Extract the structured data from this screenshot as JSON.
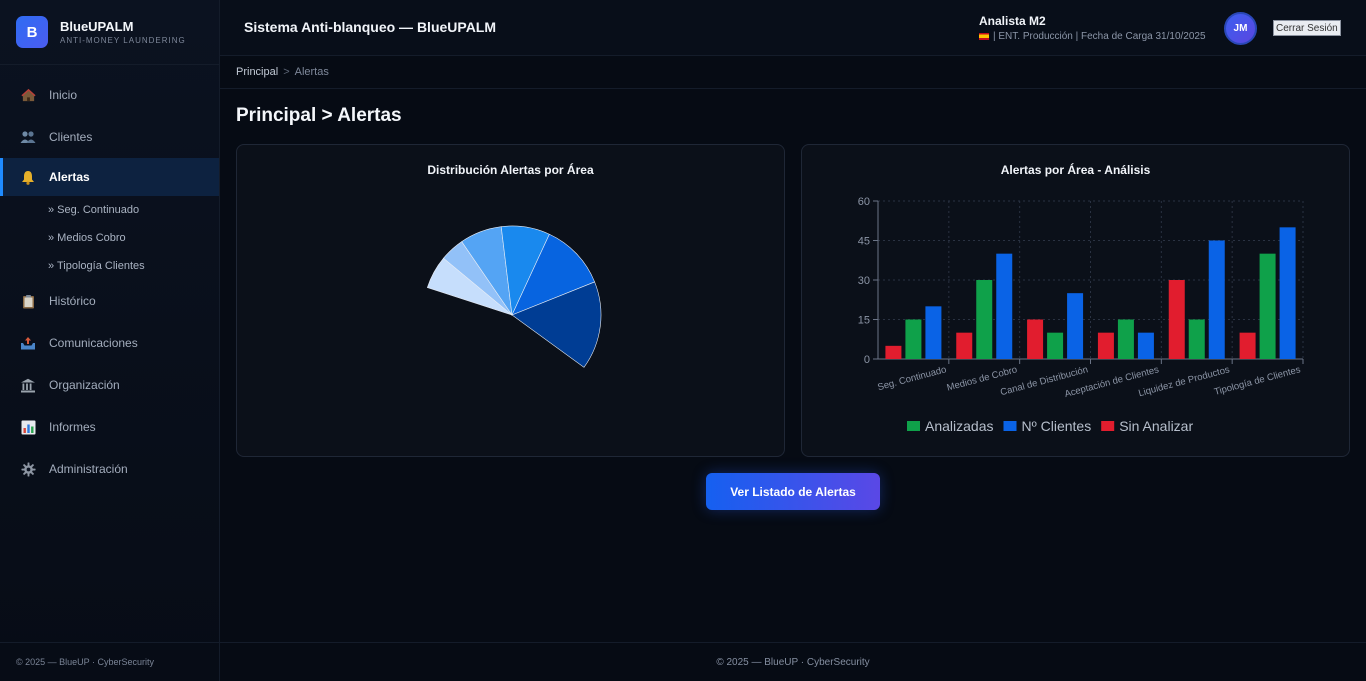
{
  "brand": {
    "logo_letter": "B",
    "name": "BlueUPALM",
    "tagline": "ANTI-MONEY LAUNDERING"
  },
  "sidebar": {
    "items": [
      {
        "label": "Inicio",
        "icon": "house-icon"
      },
      {
        "label": "Clientes",
        "icon": "users-icon"
      },
      {
        "label": "Alertas",
        "icon": "bell-icon",
        "active": true
      },
      {
        "label": "Histórico",
        "icon": "clipboard-icon"
      },
      {
        "label": "Comunicaciones",
        "icon": "outbox-icon"
      },
      {
        "label": "Organización",
        "icon": "bank-icon"
      },
      {
        "label": "Informes",
        "icon": "bar-chart-icon"
      },
      {
        "label": "Administración",
        "icon": "gear-icon"
      }
    ],
    "subitems": [
      "» Seg. Continuado",
      "» Medios Cobro",
      "» Tipología Clientes"
    ],
    "footer": "© 2025 — BlueUP · CyberSecurity"
  },
  "header": {
    "title": "Sistema Anti-blanqueo — BlueUPALM",
    "user_name": "Analista M2",
    "user_meta": "| ENT. Producción | Fecha de Carga 31/10/2025",
    "avatar_initials": "JM",
    "logout_label": "Cerrar Sesión"
  },
  "breadcrumb": {
    "home": "Principal",
    "separator": ">",
    "current": "Alertas"
  },
  "page": {
    "title": "Principal > Alertas",
    "cta_label": "Ver Listado de Alertas",
    "footer": "© 2025 — BlueUP · CyberSecurity"
  },
  "colors": {
    "accent": "#1f8bff",
    "analizadas": "#0fa14a",
    "clientes": "#0a63e6",
    "sin_analizar": "#e11d2e"
  },
  "chart_data": [
    {
      "type": "pie",
      "title": "Distribución Alertas por Área",
      "layout": "semicircle",
      "slices": [
        {
          "value": 15,
          "color": "#c6defc"
        },
        {
          "value": 11,
          "color": "#92c1f8"
        },
        {
          "value": 19,
          "color": "#54a4f4"
        },
        {
          "value": 22,
          "color": "#1989ee"
        },
        {
          "value": 30,
          "color": "#0764e0"
        },
        {
          "value": 40,
          "color": "#003d94"
        }
      ]
    },
    {
      "type": "bar",
      "title": "Alertas por Área - Análisis",
      "categories": [
        "Seg. Continuado",
        "Medios de Cobro",
        "Canal de Distribución",
        "Aceptación de Clientes",
        "Liquidez de Productos",
        "Tipología de Clientes"
      ],
      "series": [
        {
          "name": "Sin Analizar",
          "color": "#e11d2e",
          "values": [
            5,
            10,
            15,
            10,
            30,
            10
          ]
        },
        {
          "name": "Analizadas",
          "color": "#0fa14a",
          "values": [
            15,
            30,
            10,
            15,
            15,
            40
          ]
        },
        {
          "name": "Nº Clientes",
          "color": "#0a63e6",
          "values": [
            20,
            40,
            25,
            10,
            45,
            50
          ]
        }
      ],
      "legend_order": [
        "Analizadas",
        "Nº Clientes",
        "Sin Analizar"
      ],
      "yticks": [
        0,
        15,
        30,
        45,
        60
      ],
      "ylim": [
        0,
        60
      ],
      "grid": true,
      "legend_position": "bottom"
    }
  ]
}
